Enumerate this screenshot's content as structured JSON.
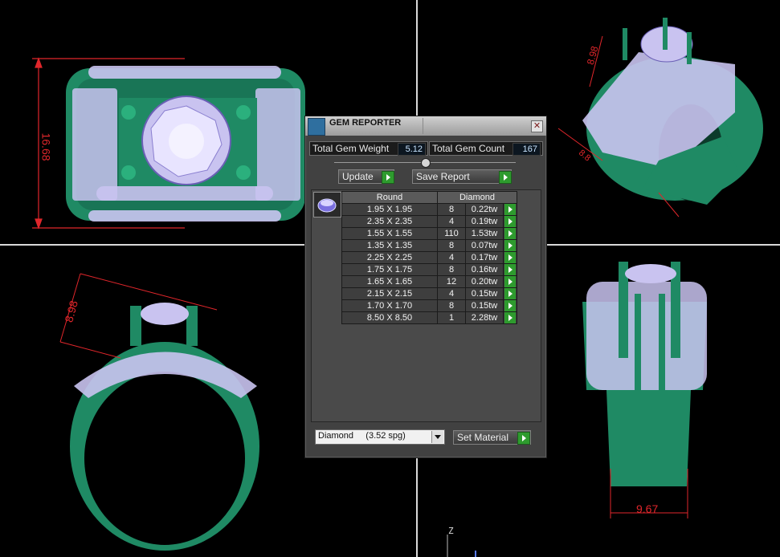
{
  "dimensions": {
    "front_height": "16.68",
    "top_right_a": "8.98",
    "top_right_b": "8.8",
    "side_left": "8.98",
    "bottom_right_width": "9.67"
  },
  "axis": {
    "z_label": "Z"
  },
  "dialog": {
    "title": "GEM REPORTER",
    "close_glyph": "✕",
    "total_weight_label": "Total Gem Weight",
    "total_weight_value": "5.12",
    "total_count_label": "Total Gem Count",
    "total_count_value": "167",
    "update_label": "Update",
    "save_label": "Save Report",
    "table": {
      "headers": [
        "Round",
        "Diamond"
      ],
      "rows": [
        {
          "size": "1.95 X 1.95",
          "count": "8",
          "weight": "0.22tw"
        },
        {
          "size": "2.35 X 2.35",
          "count": "4",
          "weight": "0.19tw"
        },
        {
          "size": "1.55 X 1.55",
          "count": "110",
          "weight": "1.53tw"
        },
        {
          "size": "1.35 X 1.35",
          "count": "8",
          "weight": "0.07tw"
        },
        {
          "size": "2.25 X 2.25",
          "count": "4",
          "weight": "0.17tw"
        },
        {
          "size": "1.75 X 1.75",
          "count": "8",
          "weight": "0.16tw"
        },
        {
          "size": "1.65 X 1.65",
          "count": "12",
          "weight": "0.20tw"
        },
        {
          "size": "2.15 X 2.15",
          "count": "4",
          "weight": "0.15tw"
        },
        {
          "size": "1.70 X 1.70",
          "count": "8",
          "weight": "0.15tw"
        },
        {
          "size": "8.50 X 8.50",
          "count": "1",
          "weight": "2.28tw"
        }
      ]
    },
    "material_select": "Diamond     (3.52 spg)",
    "set_material_label": "Set Material"
  },
  "colors": {
    "metal": "#1f8a64",
    "gem": "#c9c3f0",
    "dimension": "#e0262b",
    "accent_button": "#2e9b2e"
  }
}
